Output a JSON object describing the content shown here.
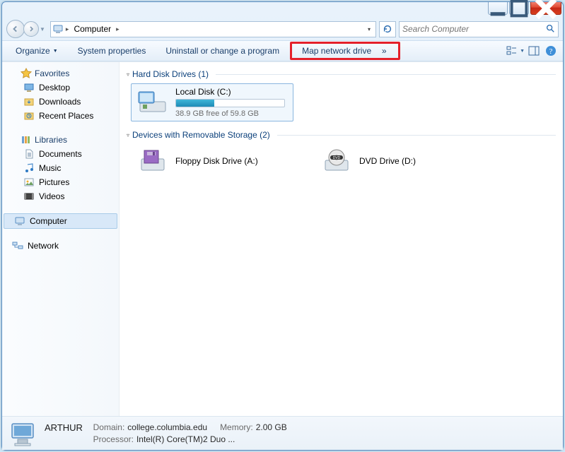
{
  "titlebar": {
    "min_tip": "Minimize",
    "max_tip": "Maximize",
    "close_tip": "Close"
  },
  "address": {
    "crumb_root_glyph": "▸",
    "crumb_label": "Computer",
    "crumb_arrow": "▸",
    "dropdown_glyph": "▾"
  },
  "search": {
    "placeholder": "Search Computer"
  },
  "toolbar": {
    "organize": "Organize",
    "sys_props": "System properties",
    "uninstall": "Uninstall or change a program",
    "map_drive": "Map network drive",
    "overflow": "»"
  },
  "navpane": {
    "favorites": {
      "label": "Favorites",
      "items": [
        "Desktop",
        "Downloads",
        "Recent Places"
      ]
    },
    "libraries": {
      "label": "Libraries",
      "items": [
        "Documents",
        "Music",
        "Pictures",
        "Videos"
      ]
    },
    "computer": {
      "label": "Computer"
    },
    "network": {
      "label": "Network"
    }
  },
  "content": {
    "hdd": {
      "header": "Hard Disk Drives (1)",
      "items": [
        {
          "name": "Local Disk (C:)",
          "free_text": "38.9 GB free of 59.8 GB",
          "used_pct": 35
        }
      ]
    },
    "removable": {
      "header": "Devices with Removable Storage (2)",
      "items": [
        {
          "name": "Floppy Disk Drive (A:)"
        },
        {
          "name": "DVD Drive (D:)"
        }
      ]
    }
  },
  "status": {
    "name": "ARTHUR",
    "domain_lbl": "Domain:",
    "domain_val": "college.columbia.edu",
    "memory_lbl": "Memory:",
    "memory_val": "2.00 GB",
    "processor_lbl": "Processor:",
    "processor_val": "Intel(R) Core(TM)2 Duo ..."
  }
}
